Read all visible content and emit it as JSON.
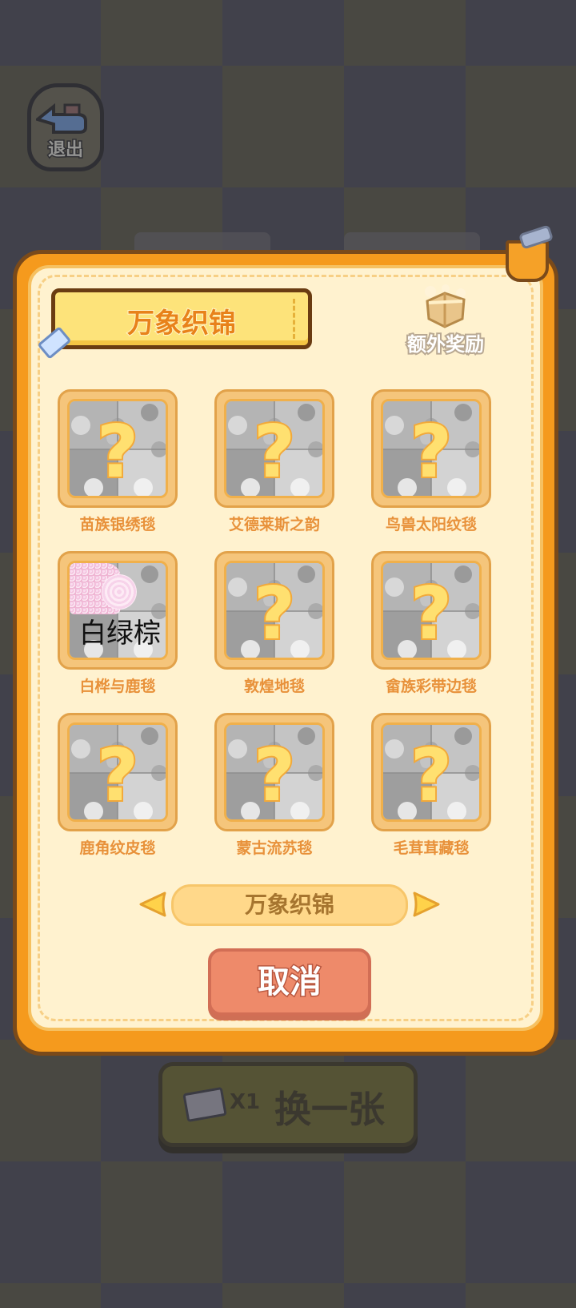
{
  "background": {
    "exit_label": "退出",
    "swap_count": "X1",
    "swap_label": "换一张"
  },
  "dialog": {
    "title": "万象织锦",
    "reward_label": "额外奖励",
    "cards": [
      {
        "name": "苗族银绣毯",
        "state": "locked"
      },
      {
        "name": "艾德莱斯之韵",
        "state": "locked"
      },
      {
        "name": "鸟兽太阳纹毯",
        "state": "locked"
      },
      {
        "name": "白桦与鹿毯",
        "state": "partial",
        "overlay_text": "白绿棕"
      },
      {
        "name": "敦煌地毯",
        "state": "locked"
      },
      {
        "name": "畲族彩带边毯",
        "state": "locked"
      },
      {
        "name": "鹿角纹皮毯",
        "state": "locked"
      },
      {
        "name": "蒙古流苏毯",
        "state": "locked"
      },
      {
        "name": "毛茸茸藏毯",
        "state": "locked"
      }
    ],
    "locked_symbol": "?",
    "selector_label": "万象织锦",
    "cancel_label": "取消"
  },
  "colors": {
    "panel": "#f59a1d",
    "panel_inner": "#fff2cf",
    "card_name": "#e8913a",
    "cancel": "#ee8a6a"
  }
}
